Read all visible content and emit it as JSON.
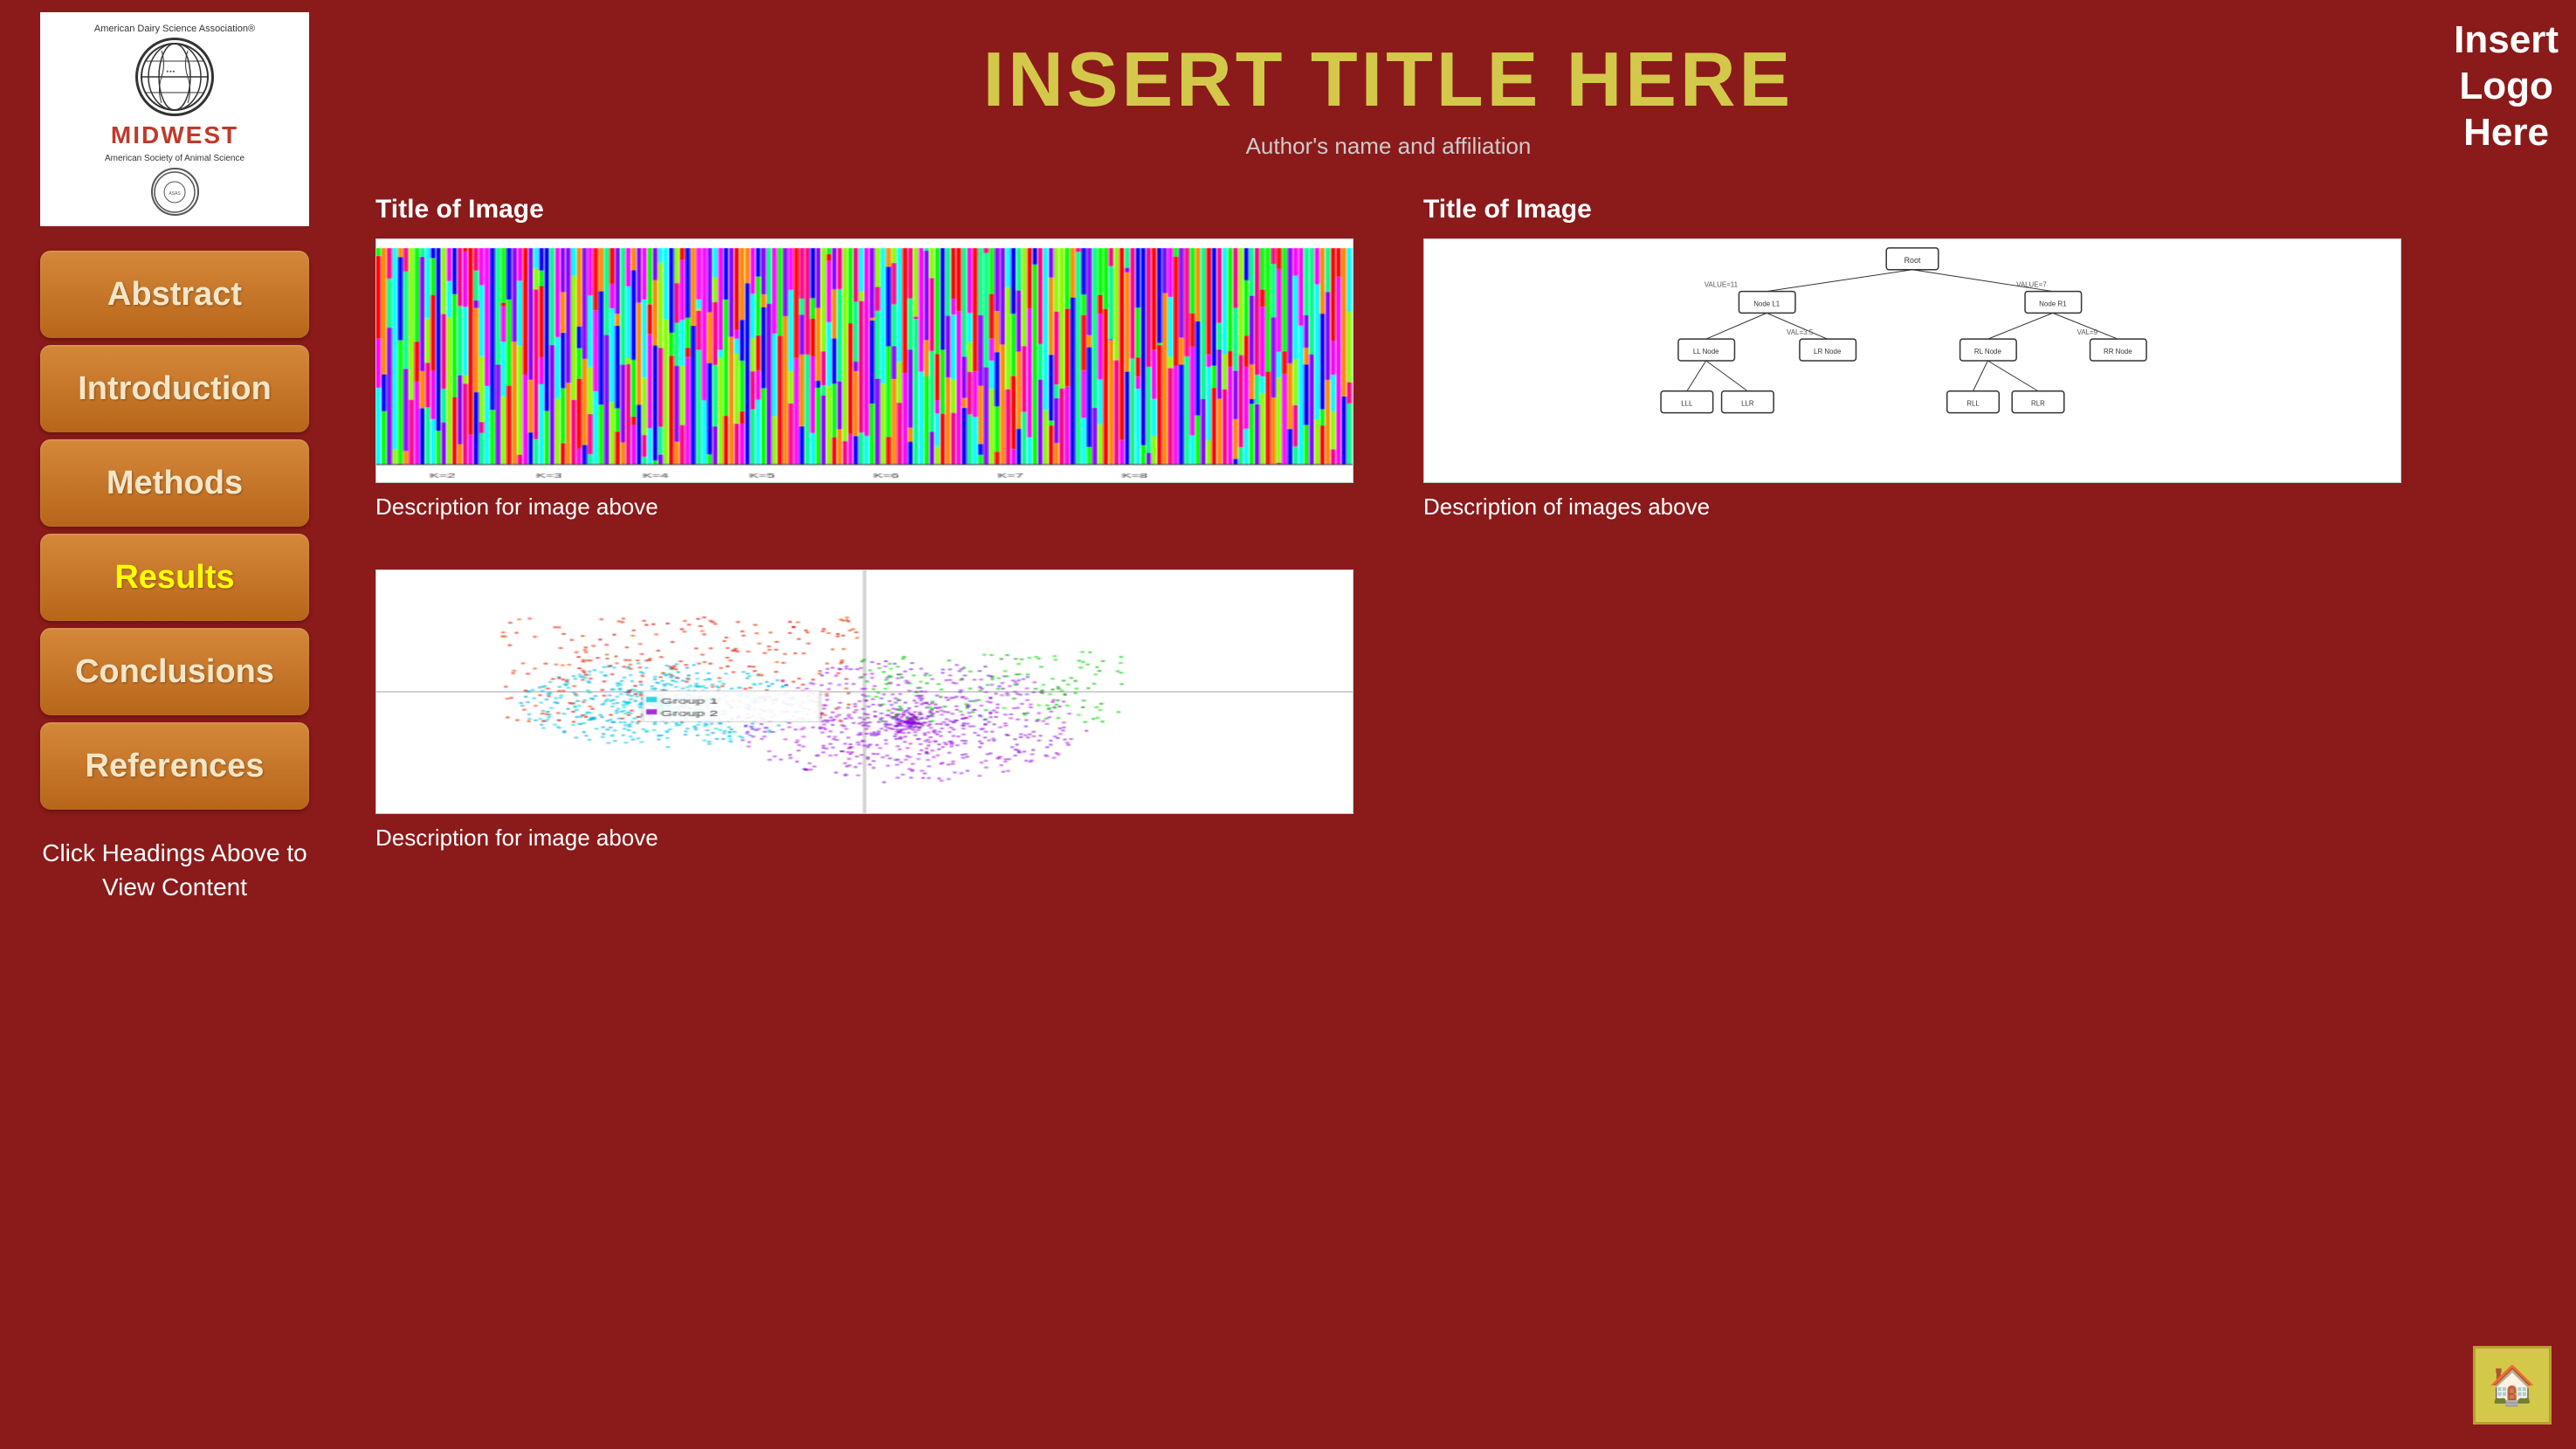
{
  "page": {
    "title": "INSERT TITLE HERE",
    "author": "Author's name and affiliation"
  },
  "sidebar": {
    "logo_top_text": "American Dairy Science Association®",
    "logo_midwest_text": "MIDWEST",
    "logo_bottom_text": "American Society of Animal Science",
    "nav": [
      {
        "id": "abstract",
        "label": "Abstract",
        "highlighted": false
      },
      {
        "id": "introduction",
        "label": "Introduction",
        "highlighted": false
      },
      {
        "id": "methods",
        "label": "Methods",
        "highlighted": false
      },
      {
        "id": "results",
        "label": "Results",
        "highlighted": true
      },
      {
        "id": "conclusions",
        "label": "Conclusions",
        "highlighted": false
      },
      {
        "id": "references",
        "label": "References",
        "highlighted": false
      }
    ],
    "hint": "Click Headings Above to View Content"
  },
  "images": [
    {
      "id": "image1",
      "title": "Title of Image",
      "type": "bar-chart",
      "description": "Description for image above"
    },
    {
      "id": "image2",
      "title": "Title of Image",
      "type": "tree-diagram",
      "description": "Description of images above"
    },
    {
      "id": "image3",
      "title": "",
      "type": "scatter-plot",
      "description": "Description for image above"
    }
  ],
  "logo_placeholder": {
    "text": "Insert\nLogo\nHere"
  },
  "home_button": {
    "icon": "🏠"
  }
}
